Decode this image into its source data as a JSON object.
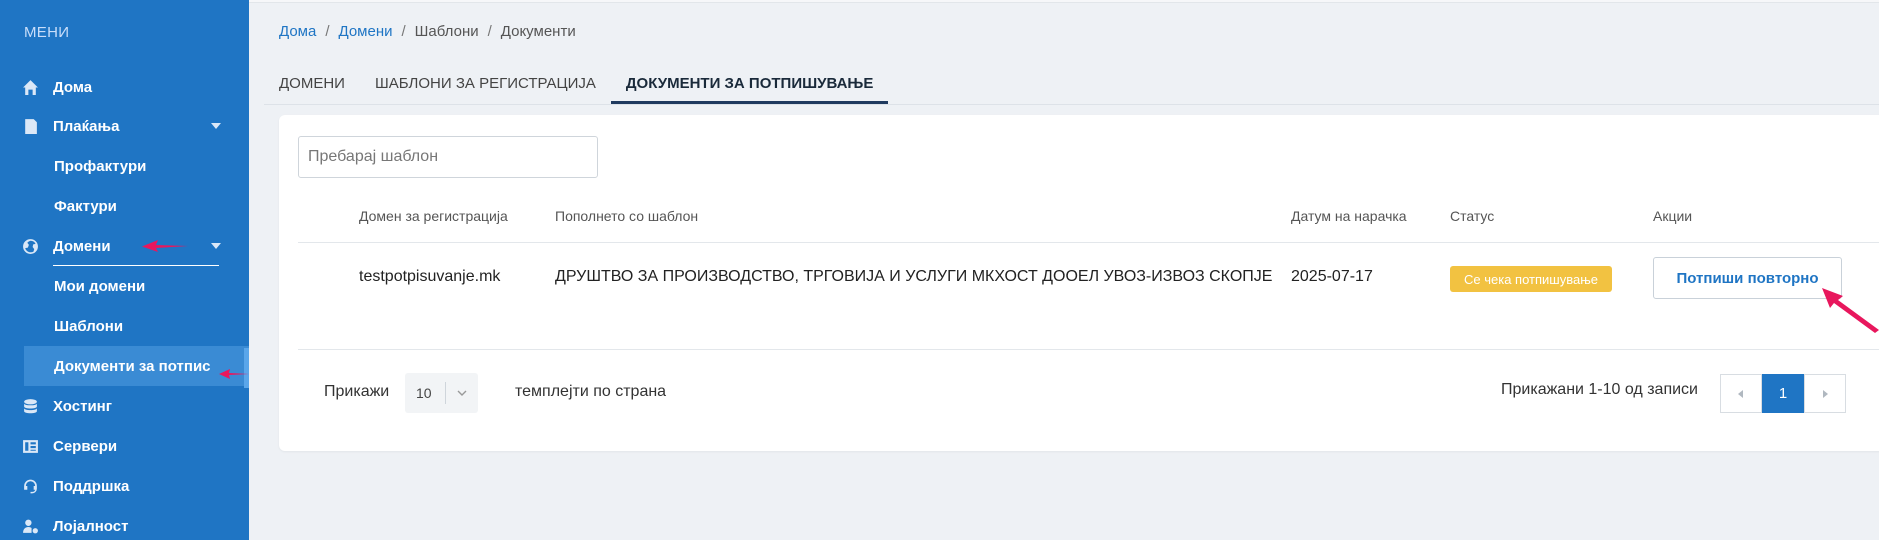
{
  "sidebar": {
    "menu_title": "МЕНИ",
    "items": [
      {
        "label": "Дома",
        "icon": "home-icon"
      },
      {
        "label": "Плаќања",
        "icon": "invoice-icon"
      },
      {
        "label": "Профактури"
      },
      {
        "label": "Фактури"
      },
      {
        "label": "Домени",
        "icon": "globe-icon"
      },
      {
        "label": "Мои домени"
      },
      {
        "label": "Шаблони"
      },
      {
        "label": "Документи за потпис"
      },
      {
        "label": "Хостинг",
        "icon": "database-icon"
      },
      {
        "label": "Сервери",
        "icon": "server-icon"
      },
      {
        "label": "Поддршка",
        "icon": "headset-icon"
      },
      {
        "label": "Лојалност",
        "icon": "user-cog-icon"
      }
    ]
  },
  "breadcrumb": [
    "Дома",
    "Домени",
    "Шаблони",
    "Документи"
  ],
  "tabs": [
    {
      "label": "ДОМЕНИ",
      "active": false
    },
    {
      "label": "ШАБЛОНИ ЗА РЕГИСТРАЦИЈА",
      "active": false
    },
    {
      "label": "ДОКУМЕНТИ ЗА ПОТПИШУВАЊЕ",
      "active": true
    }
  ],
  "search": {
    "placeholder": "Пребарај шаблон"
  },
  "table": {
    "headers": [
      "Домен за регистрација",
      "Пополнето со шаблон",
      "Датум на нарачка",
      "Статус",
      "Акции"
    ],
    "rows": [
      {
        "domain": "testpotpisuvanje.mk",
        "template": "ДРУШТВО ЗА ПРОИЗВОДСТВО, ТРГОВИЈА И УСЛУГИ МКХОСТ ДООЕЛ УВОЗ-ИЗВОЗ СКОПЈЕ",
        "date": "2025-07-17",
        "status": "Се чека потпишување",
        "action": "Потпиши повторно"
      }
    ]
  },
  "footer": {
    "show_label": "Прикажи",
    "per_page": "10",
    "per_page_label": "темплејти по страна",
    "shown": "Прикажани 1-10 од записи",
    "current_page": "1"
  },
  "colors": {
    "sidebar": "#1f75c4",
    "accent": "#1f75c4",
    "badge": "#f2c241",
    "annotation": "#e8175d"
  }
}
